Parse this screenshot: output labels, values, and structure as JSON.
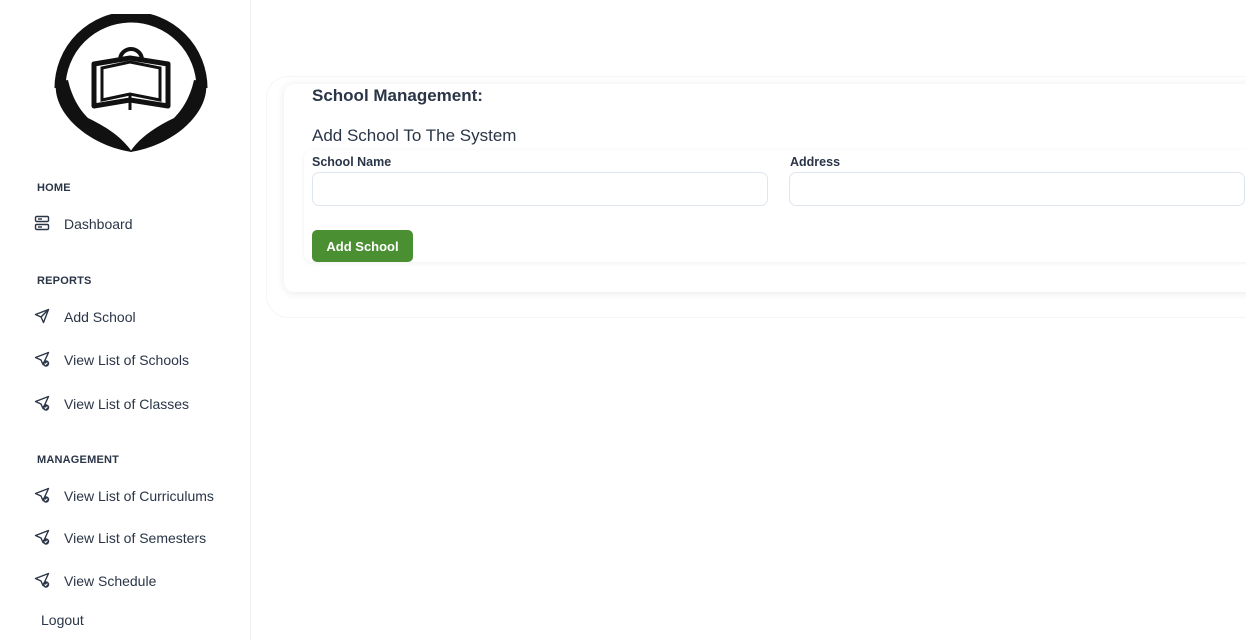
{
  "sidebar": {
    "sections": [
      {
        "title": "HOME",
        "items": [
          {
            "label": "Dashboard",
            "icon": "server-icon"
          }
        ]
      },
      {
        "title": "REPORTS",
        "items": [
          {
            "label": "Add School",
            "icon": "send-icon"
          },
          {
            "label": "View List of Schools",
            "icon": "send-check-icon"
          },
          {
            "label": "View List of Classes",
            "icon": "send-check-icon"
          }
        ]
      },
      {
        "title": "MANAGEMENT",
        "items": [
          {
            "label": "View List of Curriculums",
            "icon": "send-check-icon"
          },
          {
            "label": "View List of Semesters",
            "icon": "send-check-icon"
          },
          {
            "label": "View Schedule",
            "icon": "send-check-icon"
          }
        ]
      }
    ],
    "logout": "Logout"
  },
  "main": {
    "card_title": "School Management:",
    "form_title": "Add School To The System",
    "fields": {
      "school_name": {
        "label": "School Name",
        "value": ""
      },
      "address": {
        "label": "Address",
        "value": ""
      }
    },
    "submit_label": "Add School"
  },
  "colors": {
    "primary_button": "#4a8f32",
    "text": "#2a3547"
  }
}
